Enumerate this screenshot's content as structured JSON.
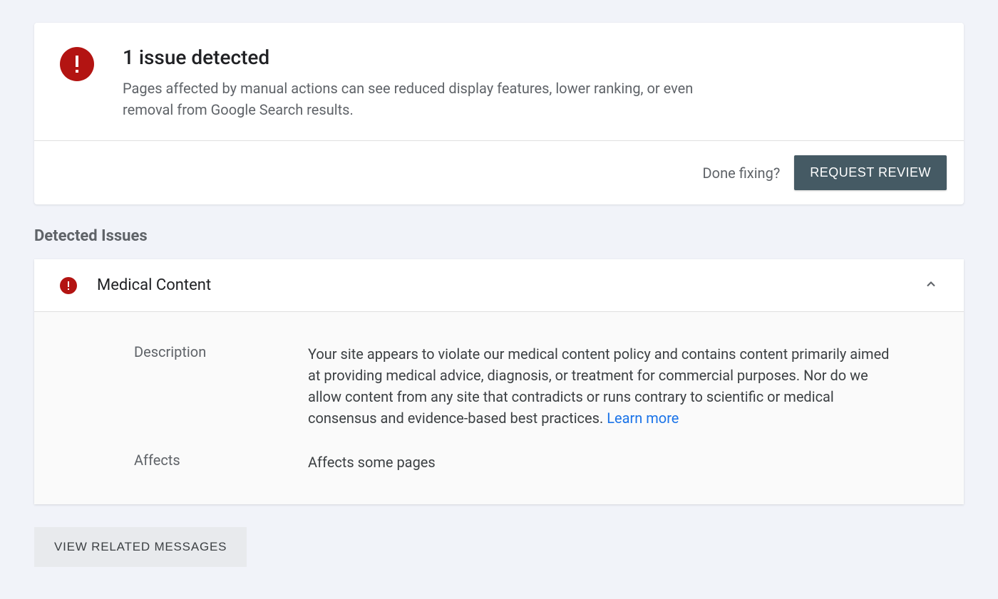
{
  "summary": {
    "title": "1 issue detected",
    "subtitle": "Pages affected by manual actions can see reduced display features, lower ranking, or even removal from Google Search results.",
    "done_fixing_label": "Done fixing?",
    "request_review_label": "REQUEST REVIEW"
  },
  "section_heading": "Detected Issues",
  "issue": {
    "title": "Medical Content",
    "description_label": "Description",
    "description_value": "Your site appears to violate our medical content policy and contains content primarily aimed at providing medical advice, diagnosis, or treatment for commercial purposes. Nor do we allow content from any site that contradicts or runs contrary to scientific or medical consensus and evidence-based best practices. ",
    "learn_more_label": "Learn more",
    "affects_label": "Affects",
    "affects_value": "Affects some pages"
  },
  "view_related_label": "VIEW RELATED MESSAGES"
}
